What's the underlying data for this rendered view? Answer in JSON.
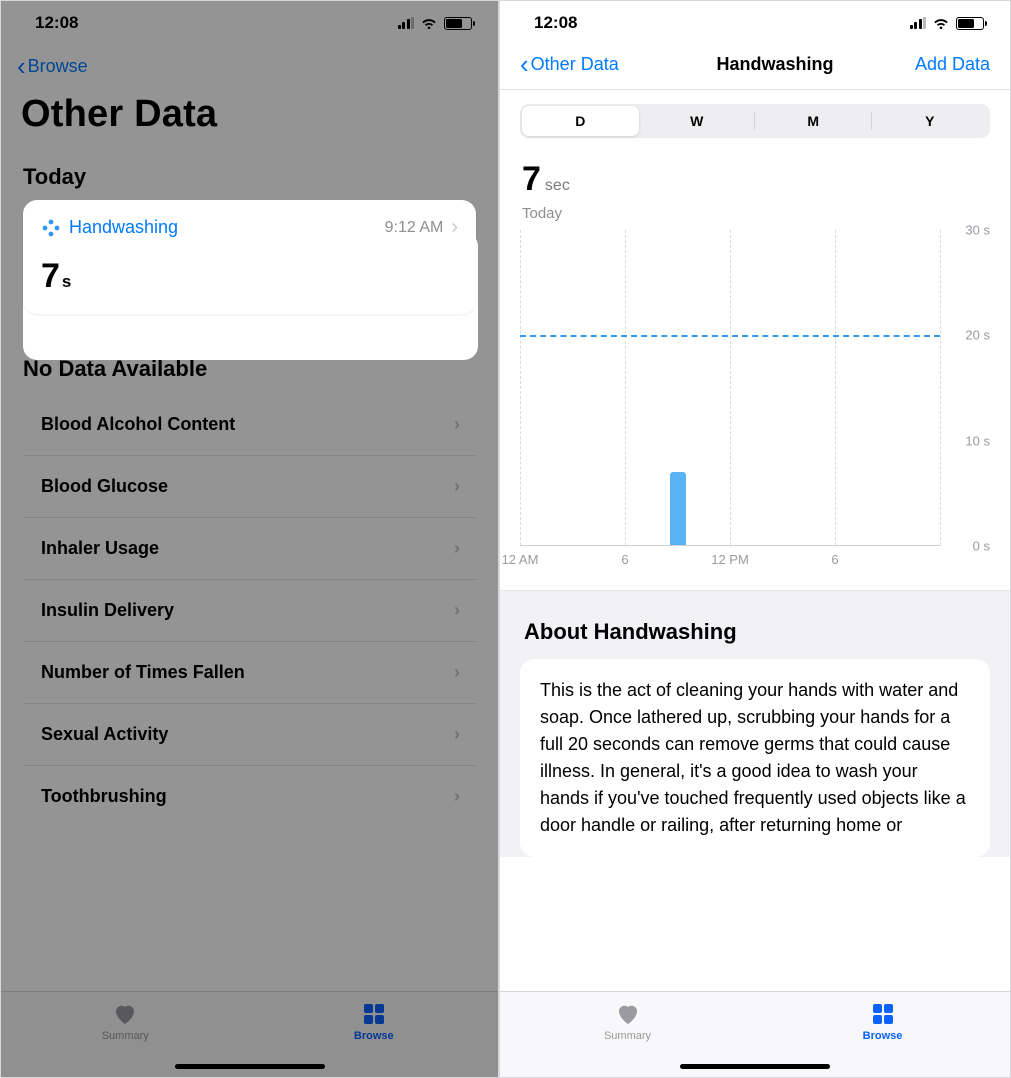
{
  "status": {
    "time": "12:08"
  },
  "left": {
    "back": "Browse",
    "big_title": "Other Data",
    "today_head": "Today",
    "card": {
      "title": "Handwashing",
      "time": "9:12 AM",
      "value": "7",
      "unit": "s"
    },
    "nodata_head": "No Data Available",
    "items": [
      "Blood Alcohol Content",
      "Blood Glucose",
      "Inhaler Usage",
      "Insulin Delivery",
      "Number of Times Fallen",
      "Sexual Activity",
      "Toothbrushing"
    ]
  },
  "right": {
    "back": "Other Data",
    "title": "Handwashing",
    "action": "Add Data",
    "segments": [
      "D",
      "W",
      "M",
      "Y"
    ],
    "metric_value": "7",
    "metric_unit": "sec",
    "metric_sub": "Today",
    "about_title": "About Handwashing",
    "about_body": "This is the act of cleaning your hands with water and soap. Once lathered up, scrubbing your hands for a full 20 seconds can remove germs that could cause illness. In general, it's a good idea to wash your hands if you've touched frequently used objects like a door handle or railing, after returning home or"
  },
  "tabs": {
    "summary": "Summary",
    "browse": "Browse"
  },
  "chart_data": {
    "type": "bar",
    "categories": [
      "12 AM",
      "6",
      "12 PM",
      "6"
    ],
    "values": [
      null,
      null,
      null,
      null
    ],
    "bars": [
      {
        "hour": 9,
        "value": 7
      }
    ],
    "reference": 20,
    "ylim": [
      0,
      30
    ],
    "yticks": [
      0,
      10,
      20,
      30
    ],
    "ylabel_suffix": " s"
  }
}
